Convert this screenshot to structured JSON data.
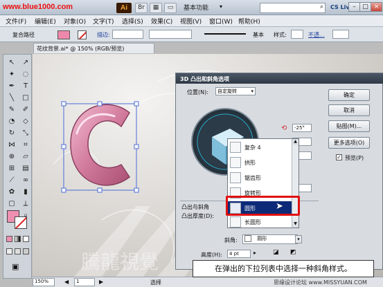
{
  "titlebar": {
    "watermark": "www.blue1000.com",
    "app_logo": "Ai",
    "workspace": "基本功能",
    "cslive": "CS Live",
    "btn_min": "–",
    "btn_max": "□",
    "btn_close": "×"
  },
  "menubar": {
    "items": [
      "文件(F)",
      "编辑(E)",
      "对象(O)",
      "文字(T)",
      "选择(S)",
      "效果(C)",
      "视图(V)",
      "窗口(W)",
      "帮助(H)"
    ]
  },
  "controlbar": {
    "path_label": "复合路径",
    "stroke_label": "描边:",
    "basic_label": "基本",
    "style_label": "样式:",
    "opacity_label": "不透..."
  },
  "document": {
    "tab_title": "花纹背景.ai* @ 150% (RGB/预览)",
    "zoom": "150%",
    "page": "1",
    "status": "选择",
    "bg_watermark": "騰龍視覺"
  },
  "dialog": {
    "title": "3D 凸出和斜角选项",
    "position_label": "位置(N):",
    "position_value": "自定旋转",
    "rotation_value": "-25°",
    "ok": "确定",
    "cancel": "取消",
    "map": "贴图(M)...",
    "more": "更多选项(O)",
    "preview_label": "预览(P)",
    "extrude_section": "凸出与斜角",
    "extrude_depth": "凸出厚度(D):",
    "bevel_label": "斜角:",
    "bevel_value": "圆形",
    "height_label": "高度(H):",
    "height_value": "4 pt"
  },
  "dropdown": {
    "items": [
      "复杂 4",
      "拱形",
      "锯齿形",
      "旋转形",
      "圆形",
      "长圆形"
    ],
    "selected_index": 4
  },
  "caption": {
    "text": "在弹出的下拉列表中选择一种斜角样式。"
  },
  "footer_watermark": "思缘设计论坛 www.MISSYUAN.COM",
  "colors": {
    "selected": "#0d2a78",
    "highlight": "#e01010",
    "shape_pink": "#d987a6",
    "cube": "#8fc4dc"
  }
}
